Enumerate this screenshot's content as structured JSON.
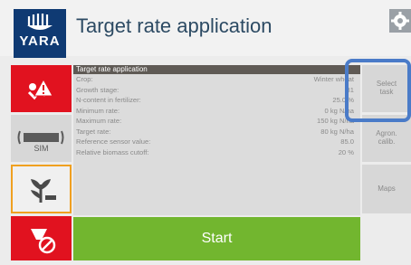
{
  "header": {
    "logo_text": "YARA",
    "title": "Target rate application"
  },
  "panel": {
    "title": "Target rate application",
    "rows": [
      {
        "label": "Crop:",
        "value": "Winter wheat"
      },
      {
        "label": "Growth stage:",
        "value": "31"
      },
      {
        "label": "N-content in fertilizer:",
        "value": "25.0 %"
      },
      {
        "label": "Minimum rate:",
        "value": "0 kg N/ha"
      },
      {
        "label": "Maximum rate:",
        "value": "150 kg N/ha"
      },
      {
        "label": "Target rate:",
        "value": "80 kg N/ha"
      },
      {
        "label": "Reference sensor value:",
        "value": "85.0"
      },
      {
        "label": "Relative biomass cutoff:",
        "value": "20 %"
      }
    ]
  },
  "right_buttons": {
    "select_task": "Select task",
    "agron_calib": "Agron. calib.",
    "maps": "Maps"
  },
  "left_buttons": {
    "sim_label": "SIM"
  },
  "start_label": "Start"
}
